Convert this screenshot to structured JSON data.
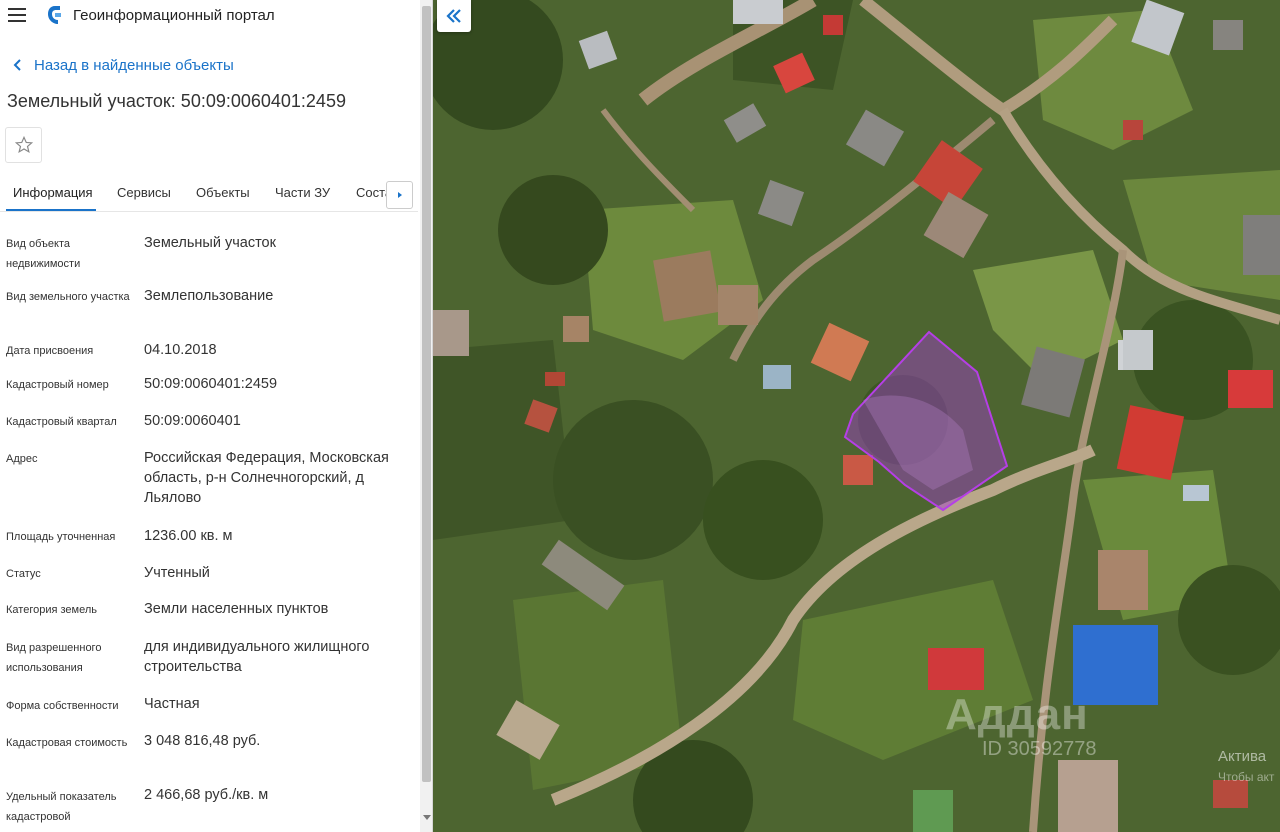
{
  "app": {
    "title": "Геоинформационный портал"
  },
  "nav": {
    "back_label": "Назад в найденные объекты"
  },
  "object": {
    "title": "Земельный участок: 50:09:0060401:2459"
  },
  "tabs": [
    {
      "label": "Информация",
      "active": true
    },
    {
      "label": "Сервисы",
      "active": false
    },
    {
      "label": "Объекты",
      "active": false
    },
    {
      "label": "Части ЗУ",
      "active": false
    },
    {
      "label": "Состав",
      "active": false
    }
  ],
  "properties": [
    {
      "label": "Вид объекта недвижимости",
      "value": "Земельный участок"
    },
    {
      "label": "Вид земельного участка",
      "value": "Землепользование"
    },
    {
      "label": "Дата присвоения",
      "value": "04.10.2018"
    },
    {
      "label": "Кадастровый номер",
      "value": "50:09:0060401:2459"
    },
    {
      "label": "Кадастровый квартал",
      "value": "50:09:0060401"
    },
    {
      "label": "Адрес",
      "value": "Российская Федерация, Московская область, р-н Солнечногорский, д Льялово"
    },
    {
      "label": "Площадь уточненная",
      "value": "1236.00 кв. м"
    },
    {
      "label": "Статус",
      "value": "Учтенный"
    },
    {
      "label": "Категория земель",
      "value": "Земли населенных пунктов"
    },
    {
      "label": "Вид разрешенного использования",
      "value": "для индивидуального жилищного строительства"
    },
    {
      "label": "Форма собственности",
      "value": "Частная"
    },
    {
      "label": "Кадастровая стоимость",
      "value": "3 048 816,48 руб."
    },
    {
      "label": "Удельный показатель кадастровой",
      "value": "2 466,68 руб./кв. м"
    }
  ],
  "map": {
    "watermark": "Аддан",
    "watermark_id": "ID 30592778",
    "activate_title": "Актива",
    "activate_sub": "Чтобы акт",
    "parcel_color": "#a23bd1"
  },
  "colors": {
    "accent": "#1a73c9",
    "parcel": "#a23bd1"
  }
}
